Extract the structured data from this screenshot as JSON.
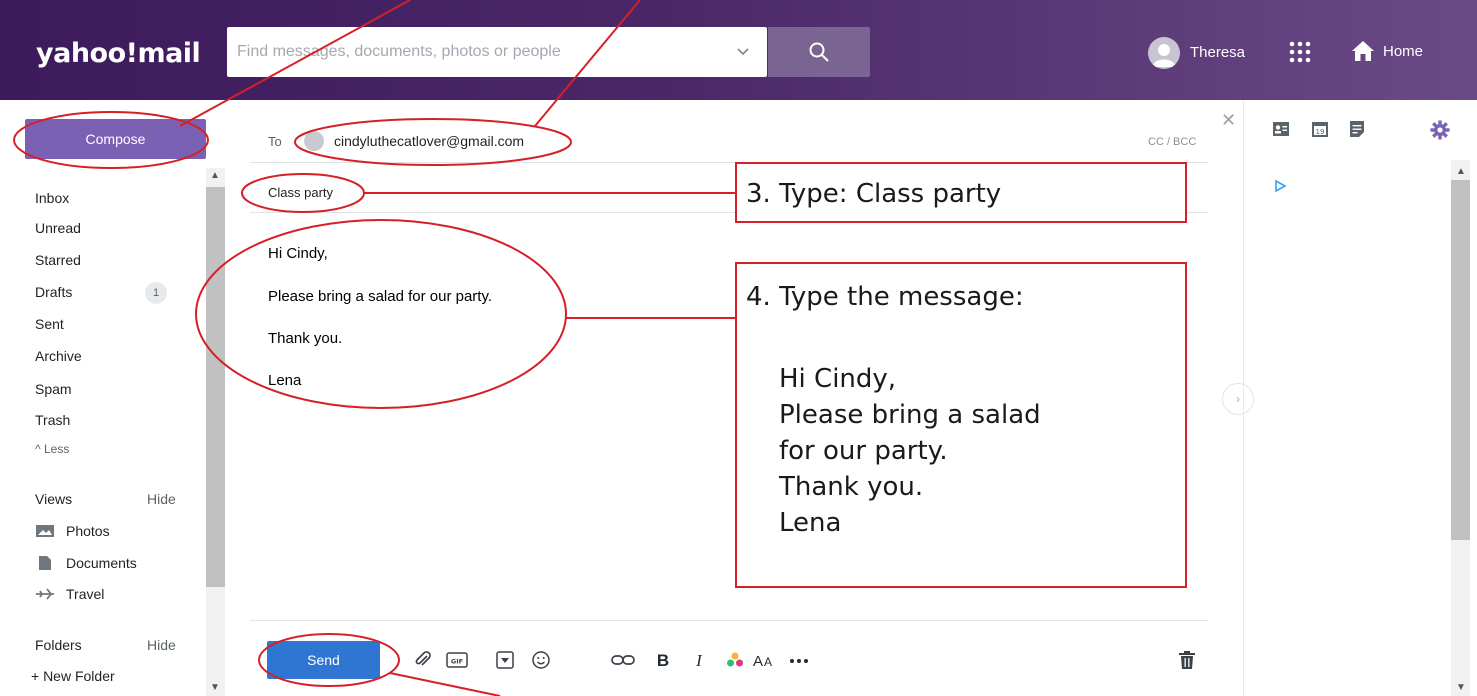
{
  "header": {
    "logo": "yahoo!mail",
    "search_placeholder": "Find messages, documents, photos or people",
    "user_name": "Theresa",
    "home_label": "Home"
  },
  "sidebar": {
    "compose_label": "Compose",
    "folders": [
      {
        "label": "Inbox"
      },
      {
        "label": "Unread"
      },
      {
        "label": "Starred"
      },
      {
        "label": "Drafts",
        "count": "1"
      },
      {
        "label": "Sent"
      },
      {
        "label": "Archive"
      },
      {
        "label": "Spam"
      },
      {
        "label": "Trash"
      },
      {
        "label": "^ Less"
      }
    ],
    "views_label": "Views",
    "views_hide": "Hide",
    "views": [
      {
        "label": "Photos",
        "icon": "photo-icon"
      },
      {
        "label": "Documents",
        "icon": "document-icon"
      },
      {
        "label": "Travel",
        "icon": "airplane-icon"
      }
    ],
    "folders_label": "Folders",
    "folders_hide": "Hide",
    "new_folder": "+ New Folder"
  },
  "compose": {
    "to_label": "To",
    "to_value": "cindyluthecatlover@gmail.com",
    "cc_bcc": "CC / BCC",
    "subject": "Class party",
    "body": [
      "Hi Cindy,",
      "Please bring a salad for our party.",
      "Thank you.",
      "Lena"
    ],
    "send_label": "Send"
  },
  "annotations": {
    "step3": "3. Type: Class party",
    "step4_title": "4. Type the message:",
    "step4_lines": [
      "Hi Cindy,",
      "Please bring a salad",
      "for our party.",
      "Thank you.",
      "Lena"
    ],
    "color": "#d52027"
  },
  "colors": {
    "header": "#4b2768",
    "compose_button": "#7b61b4",
    "send_button": "#2f76d2"
  }
}
